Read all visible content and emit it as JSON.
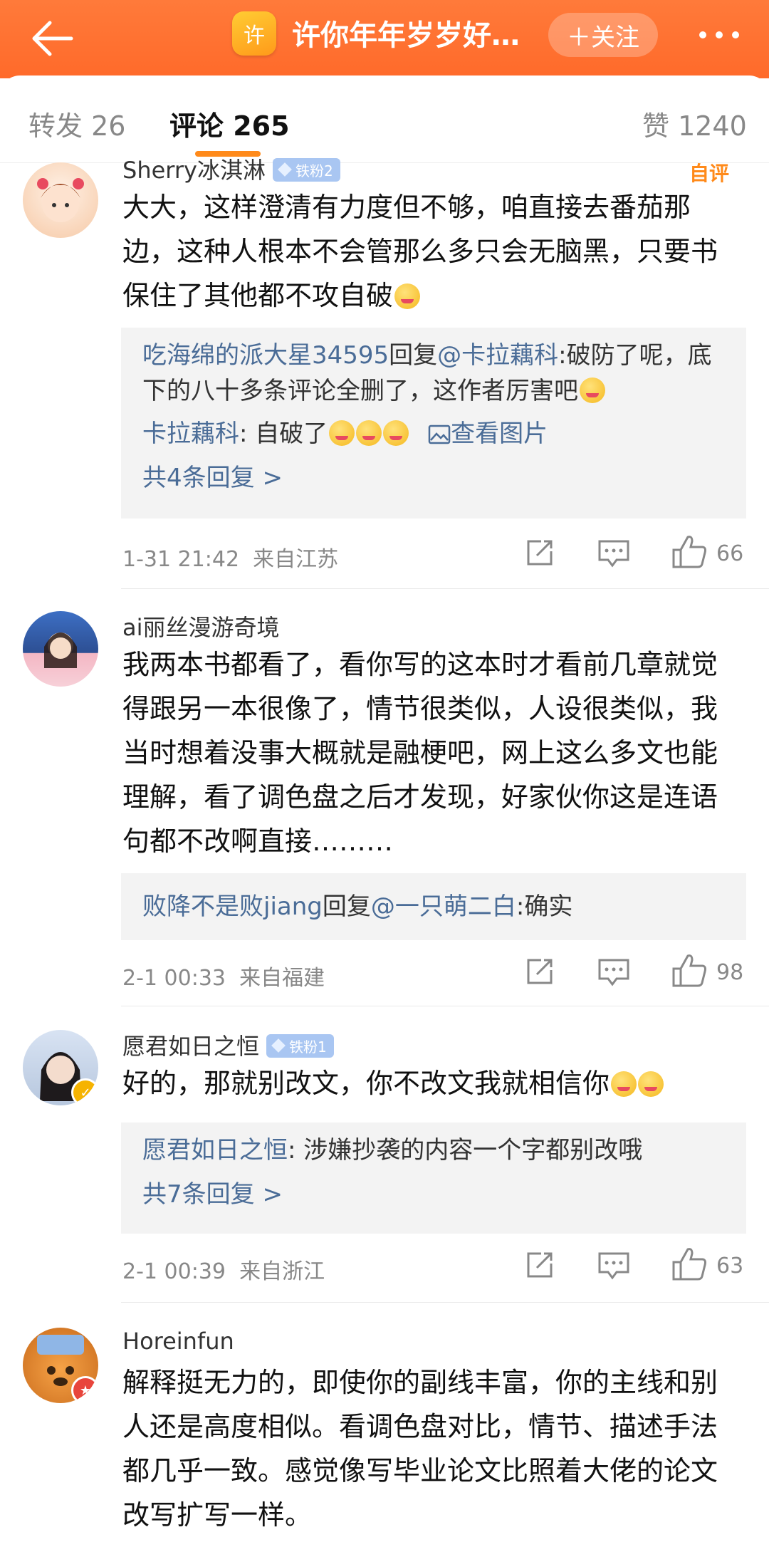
{
  "header": {
    "title": "许你年年岁岁好…",
    "logo_char": "许",
    "follow_label": "＋关注"
  },
  "tabs": {
    "repost": "转发 26",
    "comments": "评论 265",
    "likes": "赞 1240"
  },
  "colors": {
    "accent": "#ff6a2a",
    "link": "#4a6c97",
    "tab_underline": "#ff8a1a"
  },
  "comments": [
    {
      "username": "Sherry冰淇淋",
      "fan_badge": "铁粉2",
      "author_tag": "自评",
      "text": "大大，这样澄清有力度但不够，咱直接去番茄那边，这种人根本不会管那么多只会无脑黑，只要书保住了其他都不攻自破",
      "replies": [
        {
          "user": "吃海绵的派大星34595",
          "mid": "回复",
          "at": "@卡拉藕科",
          "text": ":破防了呢，底下的八十多条评论全删了，这作者厉害吧"
        },
        {
          "user": "卡拉藕科",
          "text": ": 自破了",
          "view_image": "查看图片"
        }
      ],
      "more_replies": "共4条回复 >",
      "time": "1-31 21:42",
      "location": "来自江苏",
      "likes": "66"
    },
    {
      "username": "ai丽丝漫游奇境",
      "text": "我两本书都看了，看你写的这本时才看前几章就觉得跟另一本很像了，情节很类似，人设很类似，我当时想着没事大概就是融梗吧，网上这么多文也能理解，看了调色盘之后才发现，好家伙你这是连语句都不改啊直接………",
      "replies": [
        {
          "user": "败降不是败jiang",
          "mid": "回复",
          "at": "@一只萌二白",
          "text": ":确实"
        }
      ],
      "time": "2-1 00:33",
      "location": "来自福建",
      "likes": "98"
    },
    {
      "username": "愿君如日之恒",
      "fan_badge": "铁粉1",
      "text": "好的，那就别改文，你不改文我就相信你",
      "replies": [
        {
          "user": "愿君如日之恒",
          "text": ": 涉嫌抄袭的内容一个字都别改哦"
        }
      ],
      "more_replies": "共7条回复 >",
      "time": "2-1 00:39",
      "location": "来自浙江",
      "likes": "63"
    },
    {
      "username": "Horeinfun",
      "text": "解释挺无力的，即使你的副线丰富，你的主线和别人还是高度相似。看调色盘对比，情节、描述手法都几乎一致。感觉像写毕业论文比照着大佬的论文改写扩写一样。"
    }
  ]
}
